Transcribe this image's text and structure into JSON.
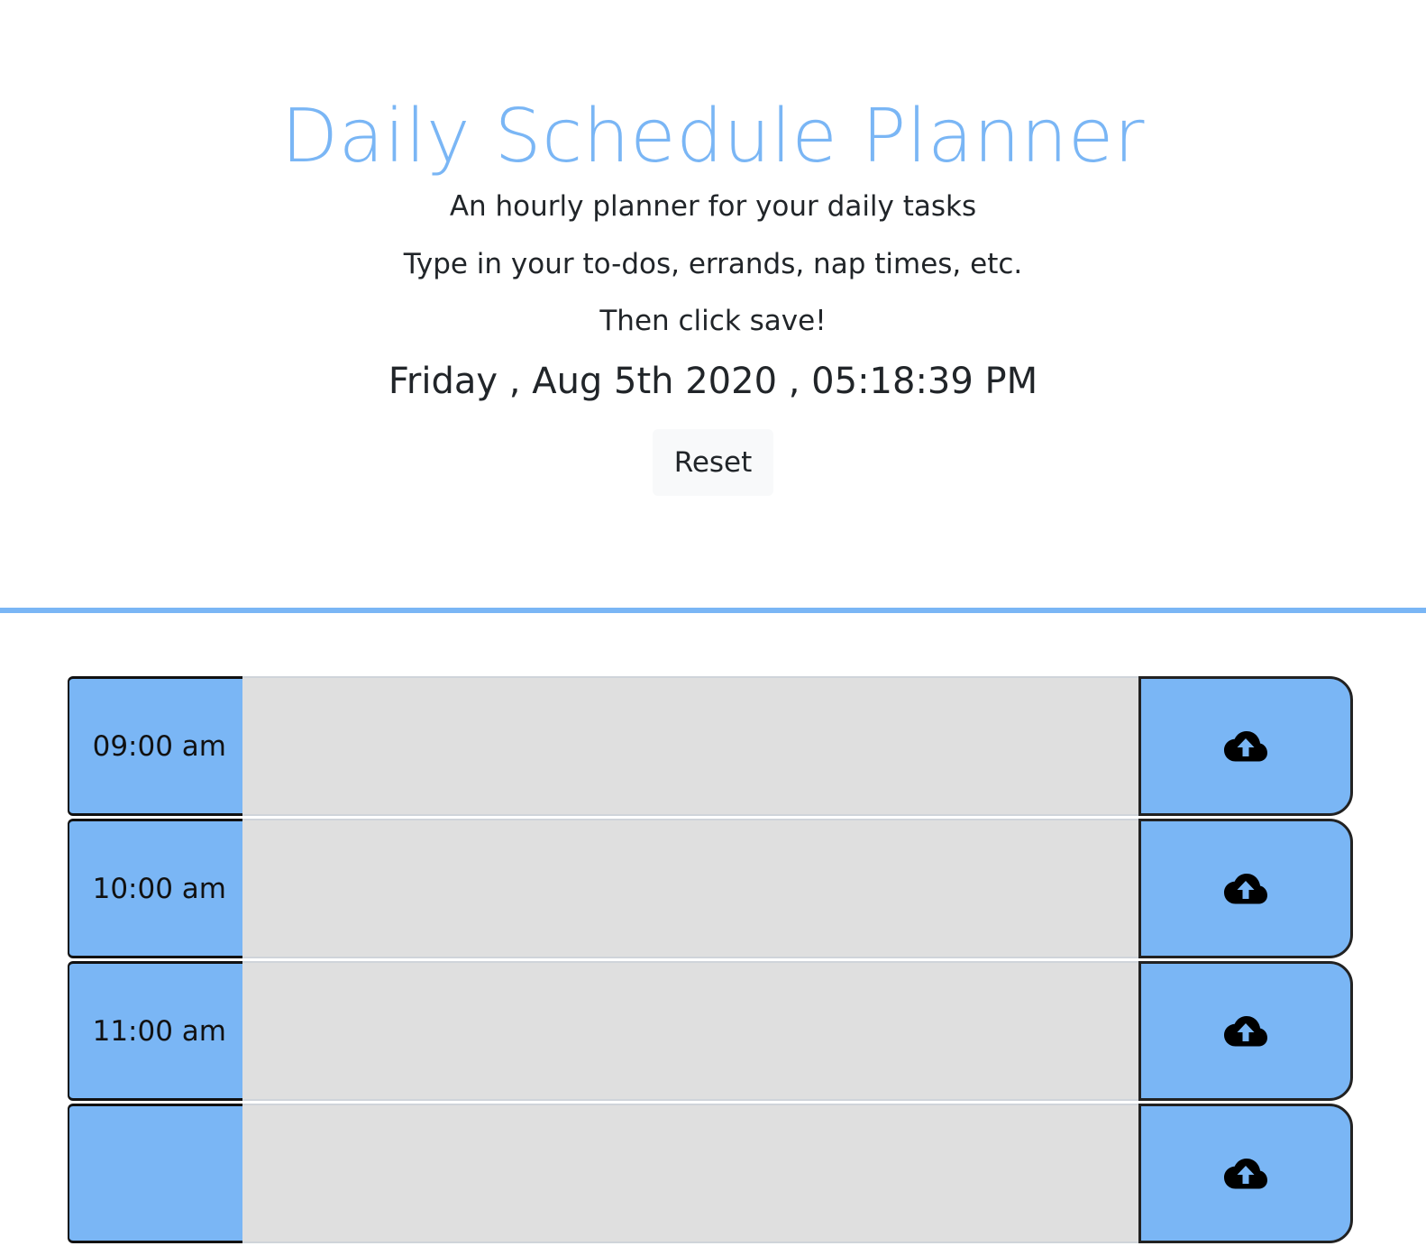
{
  "header": {
    "title": "Daily Schedule Planner",
    "subtitle_lines": [
      "An hourly planner for your daily tasks",
      "Type in your to-dos, errands, nap times, etc.",
      "Then click save!"
    ],
    "datetime": "Friday , Aug 5th 2020 , 05:18:39 PM",
    "reset_label": "Reset"
  },
  "colors": {
    "accent": "#7ab6f5",
    "textarea_bg": "#dfdfdf"
  },
  "time_blocks": [
    {
      "hour": "09:00 am",
      "text": "",
      "save_icon": "cloud-upload-icon"
    },
    {
      "hour": "10:00 am",
      "text": "",
      "save_icon": "cloud-upload-icon"
    },
    {
      "hour": "11:00 am",
      "text": "",
      "save_icon": "cloud-upload-icon"
    },
    {
      "hour": "",
      "text": "",
      "save_icon": "cloud-upload-icon"
    }
  ]
}
